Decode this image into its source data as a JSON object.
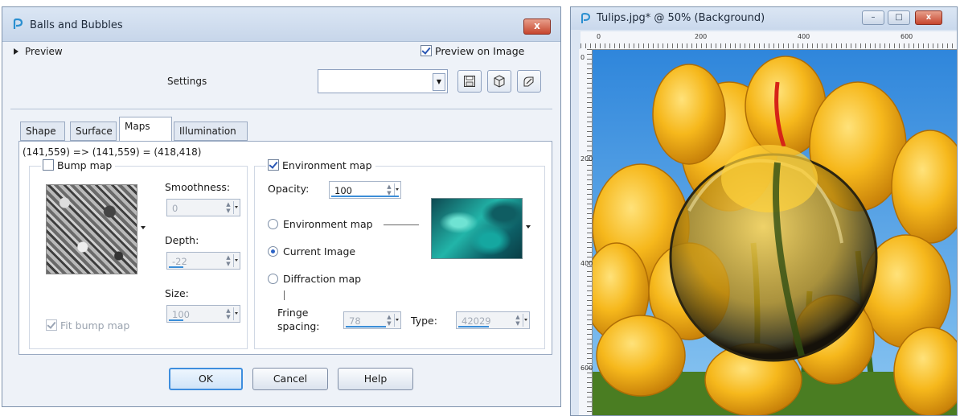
{
  "dialog": {
    "title": "Balls and Bubbles",
    "close_label": "x",
    "preview_label": "Preview",
    "preview_on_image_label": "Preview on Image",
    "preview_on_image_checked": true,
    "settings_label": "Settings",
    "settings_value": "",
    "tabs": [
      {
        "label": "Shape",
        "active": false
      },
      {
        "label": "Surface",
        "active": false
      },
      {
        "label": "Maps",
        "active": true
      },
      {
        "label": "Illumination",
        "active": false
      }
    ],
    "coords_text": "(141,559) => (141,559) = (418,418)",
    "bump_map": {
      "label": "Bump map",
      "checked": false,
      "smoothness_label": "Smoothness:",
      "smoothness_value": "0",
      "depth_label": "Depth:",
      "depth_value": "-22",
      "size_label": "Size:",
      "size_value": "100",
      "fit_label": "Fit bump map",
      "fit_checked": true
    },
    "environment": {
      "label": "Environment map",
      "checked": true,
      "opacity_label": "Opacity:",
      "opacity_value": "100",
      "options": [
        {
          "label": "Environment map",
          "selected": false
        },
        {
          "label": "Current Image",
          "selected": true
        },
        {
          "label": "Diffraction map",
          "selected": false
        }
      ],
      "fringe_label_1": "Fringe",
      "fringe_label_2": "spacing:",
      "fringe_value": "78",
      "type_label": "Type:",
      "type_value": "42029"
    },
    "buttons": {
      "ok": "OK",
      "cancel": "Cancel",
      "help": "Help"
    }
  },
  "image_window": {
    "title": "Tulips.jpg* @ 50% (Background)",
    "ruler_h_labels": [
      "0",
      "200",
      "400",
      "600"
    ],
    "ruler_v_labels": [
      "0",
      "200",
      "400",
      "600"
    ],
    "minimize_label": "–",
    "maximize_label": "□",
    "close_label": "x"
  },
  "colors": {
    "accent": "#3e8ede",
    "tulip_yellow": "#f5b417",
    "sky_blue": "#4da0e6",
    "stem_green": "#3b6b1c"
  }
}
